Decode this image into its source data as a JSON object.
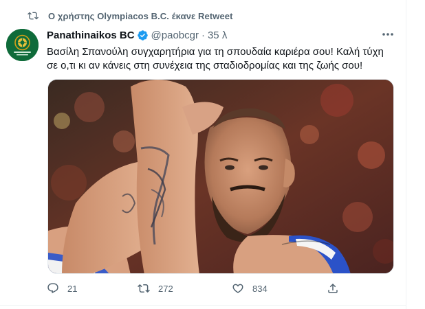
{
  "retweet_context": {
    "text": "Ο χρήστης Olympiacos B.C. έκανε Retweet",
    "icon": "retweet-icon"
  },
  "author": {
    "display_name": "Panathinaikos BC",
    "handle": "@paobcgr",
    "separator": "·",
    "time": "35 λ",
    "verified": true,
    "verified_color": "#1d9bf0",
    "avatar_bg": "#0f6b3a",
    "avatar_accent": "#d4a017"
  },
  "tweet": {
    "text_line1": "Βασίλη Σπανούλη συγχαρητήρια για τη σπουδαία καριέρα σου! Καλή τύχη",
    "text_line2": "σε ο,τι κι αν κάνεις στη συνέχεια της σταδιοδρομίας και της ζωής σου!"
  },
  "actions": {
    "reply": {
      "icon": "reply-icon",
      "count": "21"
    },
    "retweet": {
      "icon": "retweet-icon",
      "count": "272"
    },
    "like": {
      "icon": "heart-icon",
      "count": "834"
    },
    "share": {
      "icon": "share-icon"
    }
  },
  "colors": {
    "text": "#0f1419",
    "secondary": "#536471",
    "border": "#eff3f4"
  }
}
